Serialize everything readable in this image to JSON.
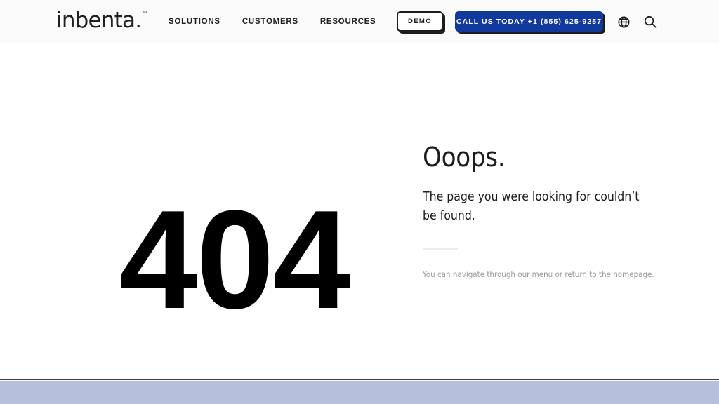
{
  "header": {
    "logo": {
      "word": "inbenta.",
      "trademark": "™"
    },
    "nav": [
      {
        "label": "SOLUTIONS"
      },
      {
        "label": "CUSTOMERS"
      },
      {
        "label": "RESOURCES"
      }
    ],
    "demo_button": "DEMO",
    "call_button": "CALL US TODAY +1 (855) 625-9257",
    "globe_icon": "globe-icon",
    "search_icon": "search-icon",
    "background_color": "#fbfbfb"
  },
  "main": {
    "error_code": "404",
    "title": "Ooops.",
    "message": "The page you were looking for couldn’t be found.",
    "hint": "You can navigate through our menu or return to the homepage.",
    "divider_color": "#ececec",
    "hint_color": "#9a9a9a"
  },
  "footer": {
    "rule_color": "#3b3b47",
    "strip_color": "#b6c0dd"
  },
  "colors": {
    "accent_blue": "#123a9e",
    "ink": "#1d1d1b",
    "page_background": "#ffffff"
  }
}
